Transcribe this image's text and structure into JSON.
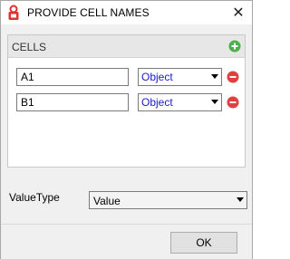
{
  "window": {
    "title": "PROVIDE CELL NAMES",
    "close_glyph": "✕"
  },
  "cells_group": {
    "label": "CELLS",
    "rows": [
      {
        "name": "A1",
        "type": "Object"
      },
      {
        "name": "B1",
        "type": "Object"
      }
    ]
  },
  "value_type": {
    "label": "ValueType",
    "selected": "Value"
  },
  "footer": {
    "ok_label": "OK"
  },
  "icons": {
    "app": "app-logo-icon",
    "add": "plus-circle-icon",
    "remove": "minus-circle-icon",
    "dropdown": "chevron-down-icon"
  },
  "colors": {
    "add_green": "#4caf50",
    "remove_red": "#e04040",
    "type_text_blue": "#1a1ac8"
  }
}
